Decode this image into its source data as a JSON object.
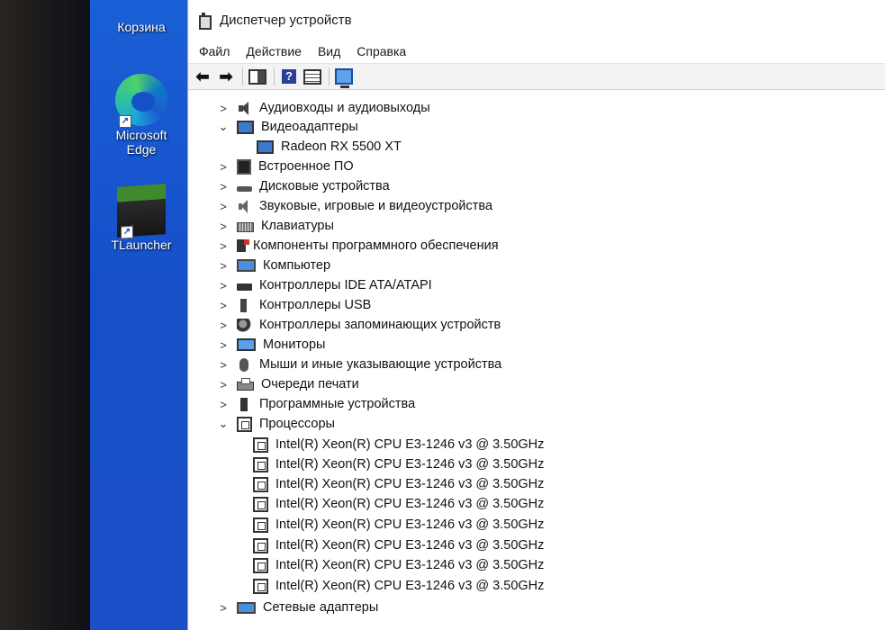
{
  "desktop": {
    "icons": [
      {
        "label": "Корзина"
      },
      {
        "label": "Microsoft\nEdge"
      },
      {
        "label": "TLauncher"
      }
    ]
  },
  "window": {
    "title": "Диспетчер устройств",
    "menu": [
      "Файл",
      "Действие",
      "Вид",
      "Справка"
    ],
    "toolbar": [
      "back-icon",
      "forward-icon",
      "show-hide-tree-icon",
      "help-icon",
      "properties-icon",
      "scan-hardware-icon"
    ]
  },
  "tree": {
    "categories": [
      {
        "label": "Аудиовходы и аудиовыходы",
        "icon": "audio-icon",
        "expanded": false
      },
      {
        "label": "Видеоадаптеры",
        "icon": "display-adapter-icon",
        "expanded": true
      },
      {
        "label": "Встроенное ПО",
        "icon": "firmware-icon",
        "expanded": false
      },
      {
        "label": "Дисковые устройства",
        "icon": "disk-icon",
        "expanded": false
      },
      {
        "label": "Звуковые, игровые и видеоустройства",
        "icon": "sound-icon",
        "expanded": false
      },
      {
        "label": "Клавиатуры",
        "icon": "keyboard-icon",
        "expanded": false
      },
      {
        "label": "Компоненты программного обеспечения",
        "icon": "software-component-icon",
        "expanded": false
      },
      {
        "label": "Компьютер",
        "icon": "computer-icon",
        "expanded": false
      },
      {
        "label": "Контроллеры IDE ATA/ATAPI",
        "icon": "ide-controller-icon",
        "expanded": false
      },
      {
        "label": "Контроллеры USB",
        "icon": "usb-icon",
        "expanded": false
      },
      {
        "label": "Контроллеры запоминающих устройств",
        "icon": "storage-controller-icon",
        "expanded": false
      },
      {
        "label": "Мониторы",
        "icon": "monitor-icon",
        "expanded": false
      },
      {
        "label": "Мыши и иные указывающие устройства",
        "icon": "mouse-icon",
        "expanded": false
      },
      {
        "label": "Очереди печати",
        "icon": "printer-icon",
        "expanded": false
      },
      {
        "label": "Программные устройства",
        "icon": "software-device-icon",
        "expanded": false
      },
      {
        "label": "Процессоры",
        "icon": "cpu-icon",
        "expanded": true
      },
      {
        "label": "Сетевые адаптеры",
        "icon": "network-adapter-icon",
        "expanded": false
      }
    ],
    "video_adapters": [
      "Radeon RX 5500 XT"
    ],
    "processors": [
      "Intel(R) Xeon(R) CPU E3-1246 v3 @ 3.50GHz",
      "Intel(R) Xeon(R) CPU E3-1246 v3 @ 3.50GHz",
      "Intel(R) Xeon(R) CPU E3-1246 v3 @ 3.50GHz",
      "Intel(R) Xeon(R) CPU E3-1246 v3 @ 3.50GHz",
      "Intel(R) Xeon(R) CPU E3-1246 v3 @ 3.50GHz",
      "Intel(R) Xeon(R) CPU E3-1246 v3 @ 3.50GHz",
      "Intel(R) Xeon(R) CPU E3-1246 v3 @ 3.50GHz",
      "Intel(R) Xeon(R) CPU E3-1246 v3 @ 3.50GHz"
    ]
  }
}
